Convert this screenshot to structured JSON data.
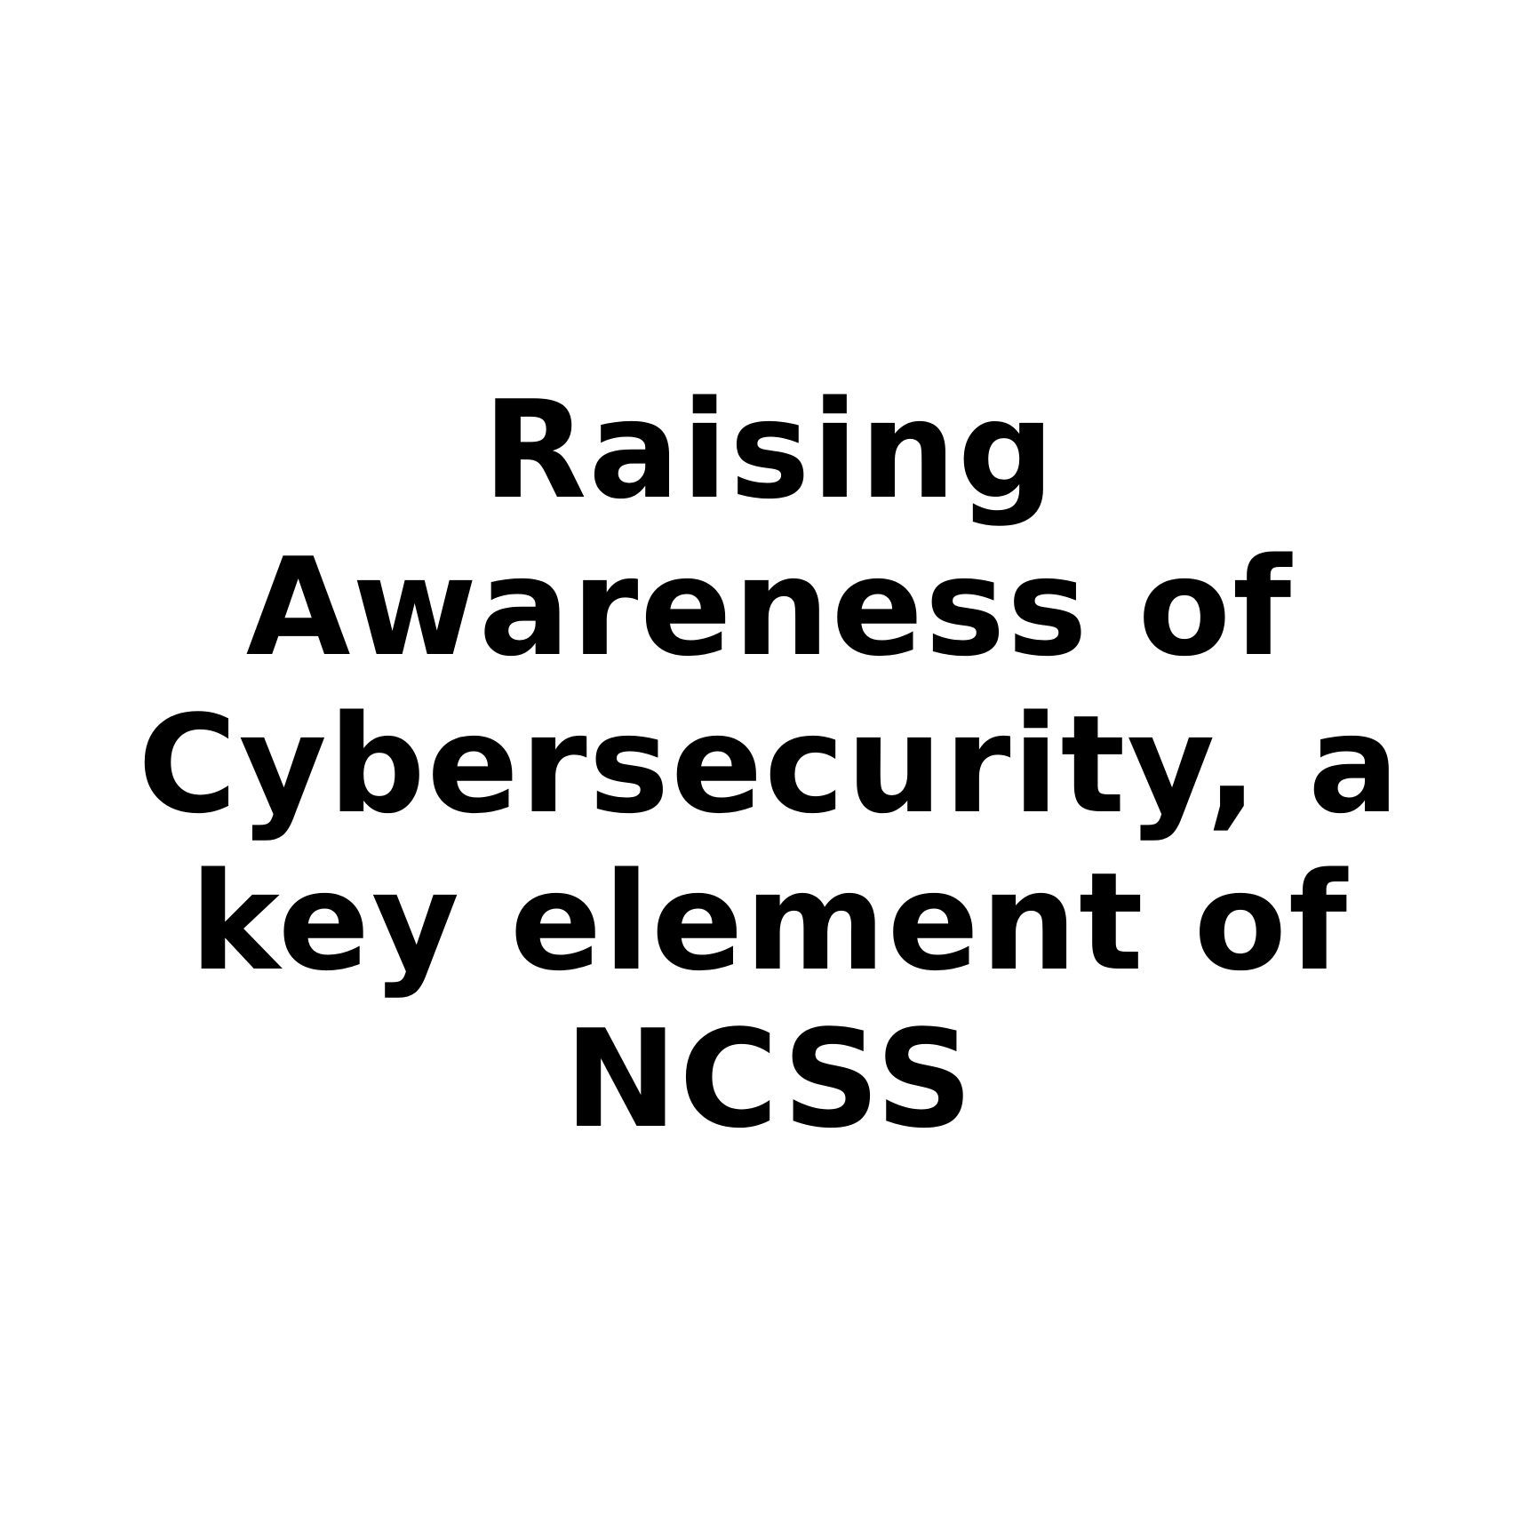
{
  "headline": {
    "lines": [
      "Raising",
      "Awareness of",
      "Cybersecurity, a",
      "key element of",
      "NCSS"
    ]
  },
  "colors": {
    "background": "#ffffff",
    "text": "#000000"
  }
}
